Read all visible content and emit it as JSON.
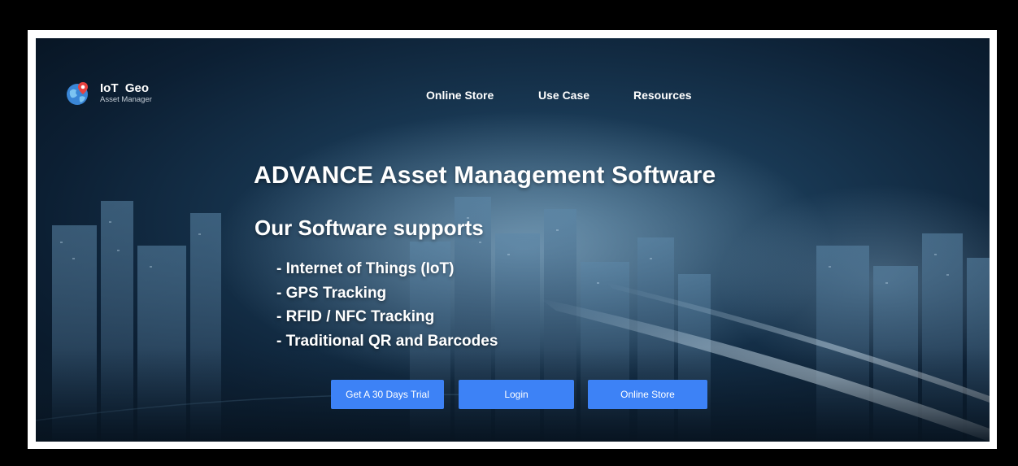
{
  "logo": {
    "title": "IoT  Geo",
    "subtitle": "Asset Manager",
    "icon": "globe-pin-icon"
  },
  "nav": {
    "items": [
      "Online Store",
      "Use Case",
      "Resources"
    ]
  },
  "hero": {
    "headline": "ADVANCE Asset Management Software",
    "subheadline": "Our Software supports",
    "features": [
      "- Internet of Things (IoT)",
      "- GPS Tracking",
      "- RFID / NFC Tracking",
      "- Traditional QR and Barcodes"
    ]
  },
  "buttons": {
    "trial": "Get A 30 Days Trial",
    "login": "Login",
    "store": "Online Store"
  },
  "colors": {
    "button": "#3d82f6",
    "frame": "#ffffff",
    "outer_background": "#000000",
    "hero_background": "#183752"
  }
}
